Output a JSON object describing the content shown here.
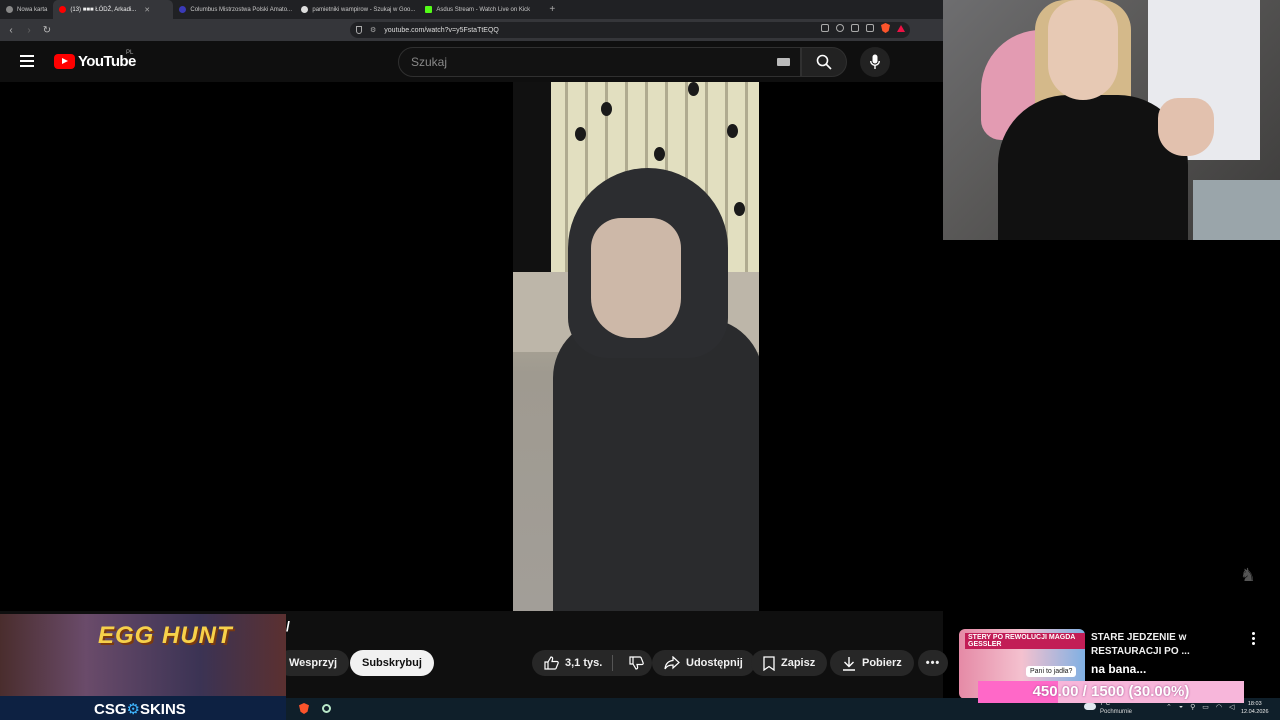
{
  "browser": {
    "tabs": [
      {
        "label": "Nowa karta",
        "color": "#888888"
      },
      {
        "label": "(13) ■■■ ŁÓDŹ, Arkadi...",
        "color": "#ff0000",
        "active": true
      },
      {
        "label": "Columbus Mistrzostwa Polski Amato...",
        "color": "#3a3ab8"
      },
      {
        "label": "pamietniki wampirow - Szukaj w Goo...",
        "color": "#dddddd"
      },
      {
        "label": "Asdus Stream - Watch Live on Kick",
        "color": "#53fc18"
      }
    ],
    "url": "youtube.com/watch?v=y5FstaTtEQQ"
  },
  "youtube": {
    "logo_text": "YouTube",
    "country": "PL",
    "search_placeholder": "Szukaj"
  },
  "video_actions": {
    "title_fragment": "/",
    "support": "Wesprzyj",
    "subscribe": "Subskrybuj",
    "likes": "3,1 tys.",
    "share": "Udostępnij",
    "save": "Zapisz",
    "download": "Pobierz"
  },
  "suggested": {
    "title": "STARE JEDZENIE w RESTAURACJI PO ...",
    "overlay_text": "na bana...",
    "thumb_caption": "STERY PO REWOLUCJI MAGDA GESSLER",
    "bubble": "Pani to jadła?"
  },
  "ad": {
    "headline": "EGG HUNT",
    "brand_a": "CSG",
    "brand_b": "SKINS"
  },
  "goal": {
    "text": "450.00 / 1500 (30.00%)",
    "progress": 0.3
  },
  "taskbar": {
    "weather_temp": "7°C",
    "weather_desc": "Pochmurnie",
    "time": "18:03",
    "date": "12.04.2026"
  },
  "colors": {
    "youtube_red": "#ff0000",
    "goal_fill": "#ff68c8",
    "goal_bg": "#f7b6da"
  }
}
